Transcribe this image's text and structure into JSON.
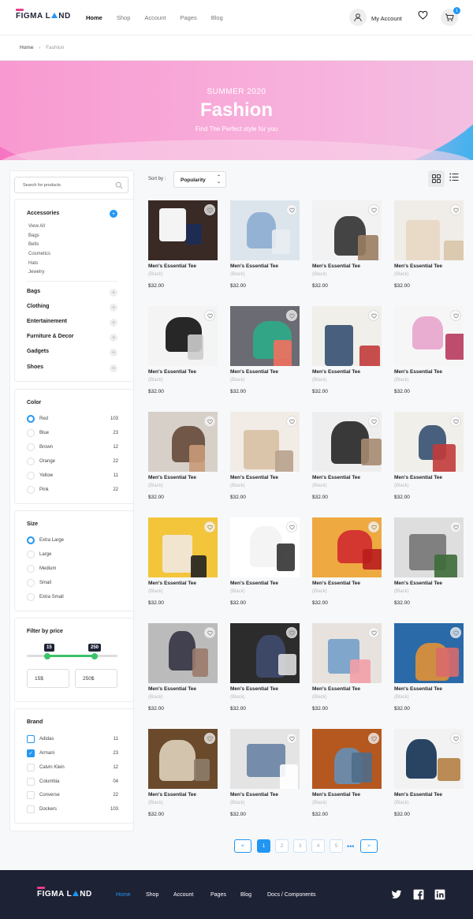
{
  "header": {
    "logo_left": "FIGMA L",
    "logo_right": "ND",
    "nav": [
      "Home",
      "Shop",
      "Account",
      "Pages",
      "Blog"
    ],
    "account_label": "My Account",
    "cart_count": "1"
  },
  "breadcrumb": {
    "home": "Home",
    "current": "Fashion"
  },
  "hero": {
    "subtitle": "SUMMER 2020",
    "title": "Fashion",
    "tagline": "Find The Perfect style for you"
  },
  "sidebar": {
    "search_placeholder": "Search for products",
    "categories": [
      {
        "label": "Accessories",
        "expanded": true,
        "children": [
          "View All",
          "Bags",
          "Belts",
          "Cosmetics",
          "Hats",
          "Jewelry"
        ]
      },
      {
        "label": "Bags"
      },
      {
        "label": "Clothing"
      },
      {
        "label": "Entertainement"
      },
      {
        "label": "Furniture & Decor"
      },
      {
        "label": "Gadgets"
      },
      {
        "label": "Shoes"
      }
    ],
    "plus": "+",
    "color": {
      "title": "Color",
      "options": [
        {
          "label": "Red",
          "count": "103",
          "selected": true
        },
        {
          "label": "Blue",
          "count": "23"
        },
        {
          "label": "Brown",
          "count": "12"
        },
        {
          "label": "Orange",
          "count": "22"
        },
        {
          "label": "Yellow",
          "count": "11"
        },
        {
          "label": "Pink",
          "count": "22"
        }
      ]
    },
    "size": {
      "title": "Size",
      "options": [
        {
          "label": "Extra Large",
          "selected": true
        },
        {
          "label": "Large"
        },
        {
          "label": "Medium"
        },
        {
          "label": "Small"
        },
        {
          "label": "Extra Small"
        }
      ]
    },
    "price": {
      "title": "Filter by price",
      "min": "15",
      "max": "250",
      "min_value": "15$",
      "max_value": "250$",
      "range_low_fraction": 0.23,
      "range_high_fraction": 0.75
    },
    "brand": {
      "title": "Brand",
      "options": [
        {
          "label": "Adidas",
          "count": "11"
        },
        {
          "label": "Armani",
          "count": "23",
          "checked": true
        },
        {
          "label": "Calvin Klein",
          "count": "12"
        },
        {
          "label": "Columbia",
          "count": "04"
        },
        {
          "label": "Converse",
          "count": "22"
        },
        {
          "label": "Dockers",
          "count": "103"
        }
      ]
    },
    "check_mark": "✓"
  },
  "toolbar": {
    "sort_label": "Sort by :",
    "sort_value": "Popularity"
  },
  "products": {
    "name": "Men's Essential Tee",
    "variant": "(Black)",
    "price": "$32.00",
    "image_palettes": [
      [
        "#3a2a26",
        "#ffffff",
        "#1c2c57"
      ],
      [
        "#dde5ec",
        "#8fb0d3",
        "#e8edf2"
      ],
      [
        "#f2f2f2",
        "#3a3a3a",
        "#9a7d62"
      ],
      [
        "#f0ede9",
        "#e8d9c5",
        "#d8c4aa"
      ],
      [
        "#f4f4f4",
        "#1b1b1b",
        "#cccccc"
      ],
      [
        "#6b6b73",
        "#2fa988",
        "#f2705f"
      ],
      [
        "#f1efea",
        "#3e5777",
        "#c23b3b"
      ],
      [
        "#f6f6f6",
        "#e9a9d0",
        "#b83b5e"
      ],
      [
        "#d7d0c8",
        "#6a5040",
        "#c89a78"
      ],
      [
        "#f1ece6",
        "#d8c3a6",
        "#b7a28c"
      ],
      [
        "#eeeeee",
        "#2e2e2e",
        "#a58b70"
      ],
      [
        "#f1efea",
        "#3e5777",
        "#c23b3b"
      ],
      [
        "#f3c53a",
        "#f0e7d8",
        "#222222"
      ],
      [
        "#ffffff",
        "#f3f3f3",
        "#333333"
      ],
      [
        "#eea941",
        "#d22f2f",
        "#b81e1e"
      ],
      [
        "#dedede",
        "#7a7a7a",
        "#3d6b37"
      ],
      [
        "#bbbbbb",
        "#3a3a4a",
        "#9b7b6b"
      ],
      [
        "#2c2c2c",
        "#3e4a6a",
        "#dddddd"
      ],
      [
        "#e7e2dd",
        "#7aa3c9",
        "#f2a0a8"
      ],
      [
        "#2a6aa8",
        "#d88f3c",
        "#d96a6a"
      ],
      [
        "#6b4a2c",
        "#d9cab4",
        "#8e7c69"
      ],
      [
        "#e4e4e4",
        "#6f88a6",
        "#ffffff"
      ],
      [
        "#b4581f",
        "#6a8cae",
        "#4f6d8a"
      ],
      [
        "#f2f2f2",
        "#1e3a5a",
        "#b57f44"
      ]
    ],
    "favorite_icon": "heart-icon"
  },
  "pagination": {
    "pages": [
      "1",
      "2",
      "3",
      "4",
      "5"
    ],
    "active": "1",
    "ellipsis": "•••",
    "prev": "<",
    "next": ">"
  },
  "footer": {
    "logo_left": "FIGMA L",
    "logo_right": "ND",
    "nav": [
      "Home",
      "Shop",
      "Account",
      "Pages",
      "Blog",
      "Docs / Components"
    ]
  },
  "colors": {
    "accent": "#2196f3",
    "brand_pink": "#e83e8c",
    "footer_bg": "#1e2235",
    "slider": "#3cc26b"
  }
}
